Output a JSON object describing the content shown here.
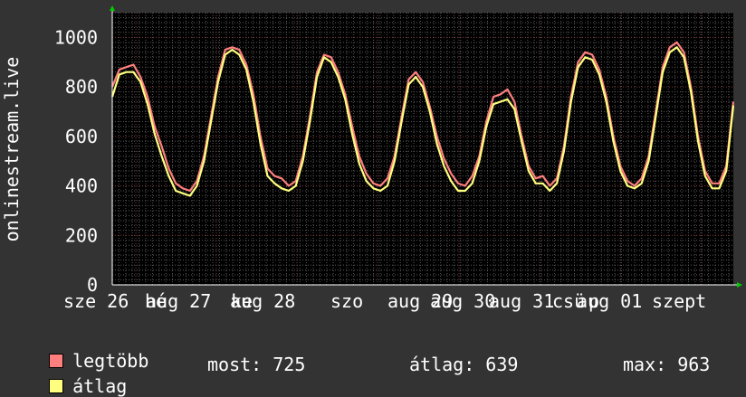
{
  "chart_data": {
    "type": "line",
    "ylabel": "onlinestream.live",
    "ylim": [
      0,
      1000
    ],
    "yticks": [
      0,
      200,
      400,
      600,
      800,
      1000
    ],
    "x_tick_labels": [
      "sze 26",
      "aug 27",
      "aug 28",
      "aug 29",
      "aug 30",
      "aug 31",
      "aug 01",
      "szept",
      "szo",
      "hé",
      "ke",
      "csü",
      "p"
    ],
    "grid": true,
    "series": [
      {
        "name": "legtöbb",
        "color": "#ff7f7f",
        "values": [
          800,
          870,
          880,
          890,
          840,
          760,
          640,
          560,
          470,
          410,
          390,
          380,
          420,
          520,
          680,
          840,
          950,
          960,
          950,
          890,
          770,
          600,
          470,
          440,
          430,
          400,
          420,
          520,
          680,
          860,
          930,
          920,
          860,
          770,
          640,
          520,
          450,
          410,
          400,
          430,
          520,
          680,
          830,
          860,
          820,
          720,
          600,
          510,
          450,
          410,
          400,
          440,
          520,
          660,
          760,
          770,
          790,
          740,
          600,
          480,
          430,
          440,
          400,
          430,
          560,
          760,
          900,
          940,
          930,
          870,
          760,
          600,
          480,
          420,
          400,
          430,
          520,
          700,
          880,
          960,
          980,
          940,
          800,
          600,
          460,
          410,
          410,
          480,
          740
        ]
      },
      {
        "name": "átlag",
        "color": "#ffff7f",
        "values": [
          760,
          850,
          860,
          860,
          820,
          730,
          610,
          520,
          440,
          380,
          370,
          360,
          400,
          500,
          660,
          820,
          930,
          950,
          930,
          870,
          740,
          570,
          440,
          410,
          390,
          380,
          400,
          500,
          660,
          840,
          920,
          900,
          840,
          750,
          610,
          490,
          420,
          390,
          380,
          400,
          500,
          660,
          810,
          840,
          800,
          700,
          570,
          480,
          420,
          380,
          380,
          410,
          500,
          640,
          730,
          740,
          750,
          710,
          580,
          460,
          410,
          410,
          380,
          410,
          540,
          740,
          880,
          920,
          910,
          850,
          740,
          580,
          460,
          400,
          390,
          410,
          500,
          680,
          860,
          940,
          960,
          920,
          780,
          580,
          440,
          390,
          390,
          460,
          725
        ]
      }
    ]
  },
  "legend": {
    "items": [
      {
        "label": "legtöbb",
        "color": "#ff7f7f"
      },
      {
        "label": "átlag",
        "color": "#ffff7f"
      }
    ],
    "stats": {
      "most": "most: 725",
      "atlag": "átlag: 639",
      "max": "max: 963"
    }
  },
  "colors": {
    "background": "#333333",
    "plot_background": "#000000",
    "grid_major": "#7f3f3f",
    "grid_minor": "#5a5a5a",
    "text": "#ffffff",
    "axis_arrow": "#00cc00"
  }
}
